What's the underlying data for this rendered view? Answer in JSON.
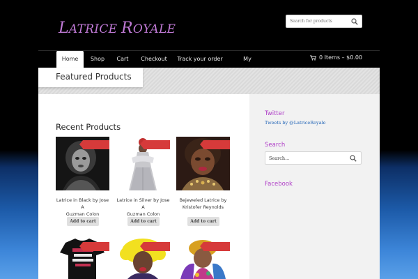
{
  "site": {
    "logo_first": "L",
    "logo_mid": "ATRICE ",
    "logo_second": "R",
    "logo_rest": "OYALE"
  },
  "header_search": {
    "placeholder": "Search for products"
  },
  "nav": {
    "items": [
      {
        "label": "Home"
      },
      {
        "label": "Shop"
      },
      {
        "label": "Cart"
      },
      {
        "label": "Checkout"
      },
      {
        "label": "Track your order"
      },
      {
        "label": "My Account"
      }
    ],
    "cart_summary": "0 Items – $0.00"
  },
  "page": {
    "title": "Featured Products"
  },
  "main": {
    "heading": "Recent Products",
    "products": [
      {
        "name_line1": "Latrice in Black by Jose A",
        "name_line2": "Guzman Colon",
        "button": "Add to cart"
      },
      {
        "name_line1": "Latrice in Silver by Jose A",
        "name_line2": "Guzman Colon",
        "button": "Add to cart"
      },
      {
        "name_line1": "Bejeweled Latrice by",
        "name_line2": "Kristofer Reynolds",
        "button": "Add to cart"
      },
      {
        "name_line1": "",
        "name_line2": "",
        "button": ""
      },
      {
        "name_line1": "",
        "name_line2": "",
        "button": ""
      },
      {
        "name_line1": "",
        "name_line2": "",
        "button": ""
      }
    ]
  },
  "sidebar": {
    "twitter_title": "Twitter",
    "twitter_link": "Tweets by @LatriceRoyale",
    "search_title": "Search",
    "search_value": "Search...",
    "facebook_title": "Facebook"
  },
  "colors": {
    "accent": "#b040c8",
    "sale_badge": "#d63a3a",
    "link": "#1a5fb4"
  }
}
